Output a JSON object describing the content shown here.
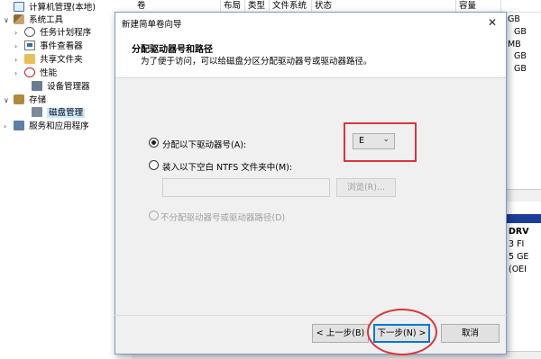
{
  "tree": {
    "items": [
      {
        "label": "计算机管理(本地)",
        "icon": "computer-icon",
        "expander": ""
      },
      {
        "label": "系统工具",
        "icon": "tools-icon",
        "expander": "∨"
      },
      {
        "label": "任务计划程序",
        "icon": "clock-icon",
        "expander": "›"
      },
      {
        "label": "事件查看器",
        "icon": "event-viewer-icon",
        "expander": "›"
      },
      {
        "label": "共享文件夹",
        "icon": "shared-folder-icon",
        "expander": "›"
      },
      {
        "label": "性能",
        "icon": "performance-icon",
        "expander": "›"
      },
      {
        "label": "设备管理器",
        "icon": "device-manager-icon",
        "expander": ""
      },
      {
        "label": "存储",
        "icon": "storage-icon",
        "expander": "∨"
      },
      {
        "label": "磁盘管理",
        "icon": "disk-management-icon",
        "expander": ""
      },
      {
        "label": "服务和应用程序",
        "icon": "services-icon",
        "expander": "›"
      }
    ]
  },
  "table": {
    "headers": [
      "卷",
      "布局",
      "类型",
      "文件系统",
      "状态",
      "容量"
    ]
  },
  "background_right": {
    "cap_fragments": [
      "GB",
      "GB",
      "MB",
      "GB",
      "GB"
    ],
    "panel_fragments": [
      "DRV",
      "3 FI",
      "5 GE",
      "(OEI"
    ]
  },
  "dialog": {
    "title": "新建简单卷向导",
    "close": "✕",
    "header_title": "分配驱动器号和路径",
    "header_sub": "为了便于访问，可以给磁盘分区分配驱动器号或驱动器路径。",
    "option_assign_letter": "分配以下驱动器号(A):",
    "drive_letter": "E",
    "option_mount_folder": "装入以下空白 NTFS 文件夹中(M):",
    "path_value": "",
    "browse": "浏览(R)...",
    "option_none": "不分配驱动器号或驱动器路径(D)",
    "back": "< 上一步(B)",
    "next": "下一步(N) >",
    "cancel": "取消"
  },
  "colors": {
    "annotation_red": "#d8363a",
    "selection": "#cce8ff",
    "primary_border": "#0078d7"
  }
}
